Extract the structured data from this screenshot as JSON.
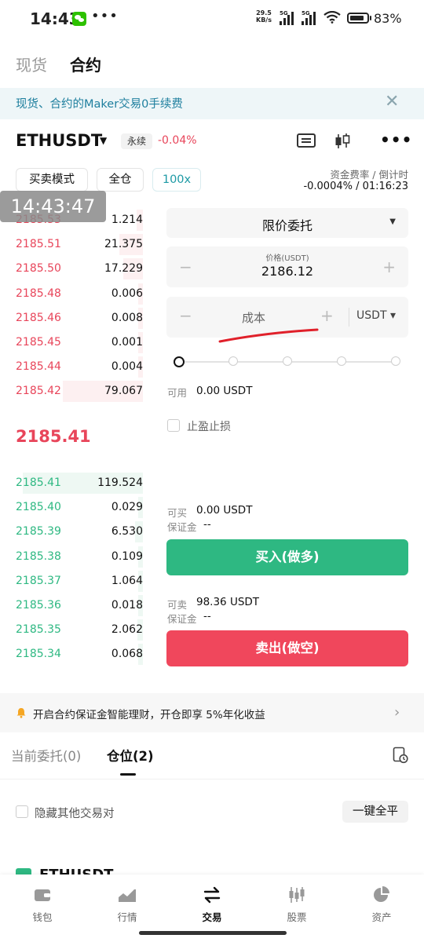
{
  "status_bar": {
    "time": "14:43",
    "dots": "•••",
    "net_speed_value": "29.5",
    "net_speed_unit": "KB/s",
    "signal_label": "5G",
    "battery_pct": "83%"
  },
  "top_tabs": {
    "spot": "现货",
    "futures": "合约"
  },
  "banner": {
    "text": "现货、合约的Maker交易0手续费",
    "close": "✕"
  },
  "header": {
    "symbol": "ETHUSDT",
    "caret": "▼",
    "tag": "永续",
    "change": "-0.04%"
  },
  "modes": {
    "trade_mode": "买卖模式",
    "margin_mode": "全仓",
    "leverage": "100x"
  },
  "funding": {
    "label": "资金费率 / 倒计时",
    "value": "-0.0004% / 01:16:23"
  },
  "overlay_time": "14:43:47",
  "orderbook": {
    "asks": [
      {
        "price": "2185.53",
        "qty": "1.214",
        "depth": 0.05
      },
      {
        "price": "2185.51",
        "qty": "21.375",
        "depth": 0.18
      },
      {
        "price": "2185.50",
        "qty": "17.229",
        "depth": 0.15
      },
      {
        "price": "2185.48",
        "qty": "0.006",
        "depth": 0.02
      },
      {
        "price": "2185.46",
        "qty": "0.008",
        "depth": 0.02
      },
      {
        "price": "2185.45",
        "qty": "0.001",
        "depth": 0.02
      },
      {
        "price": "2185.44",
        "qty": "0.004",
        "depth": 0.02
      },
      {
        "price": "2185.42",
        "qty": "79.067",
        "depth": 0.62
      }
    ],
    "mid_price": "2185.41",
    "bids": [
      {
        "price": "2185.41",
        "qty": "119.524",
        "depth": 0.93
      },
      {
        "price": "2185.40",
        "qty": "0.029",
        "depth": 0.02
      },
      {
        "price": "2185.39",
        "qty": "6.530",
        "depth": 0.06
      },
      {
        "price": "2185.38",
        "qty": "0.109",
        "depth": 0.02
      },
      {
        "price": "2185.37",
        "qty": "1.064",
        "depth": 0.03
      },
      {
        "price": "2185.36",
        "qty": "0.018",
        "depth": 0.02
      },
      {
        "price": "2185.35",
        "qty": "2.062",
        "depth": 0.04
      },
      {
        "price": "2185.34",
        "qty": "0.068",
        "depth": 0.02
      }
    ]
  },
  "order_form": {
    "order_type": "限价委托",
    "price_label": "价格(USDT)",
    "price_value": "2186.12",
    "minus": "−",
    "plus": "+",
    "cost_placeholder": "成本",
    "unit": "USDT",
    "slider_percent": 0,
    "available_label": "可用",
    "available_value": "0.00 USDT",
    "tpsl_label": "止盈止损",
    "buy_can_label": "可买",
    "buy_can_value": "0.00 USDT",
    "buy_margin_label": "保证金",
    "buy_margin_value": "--",
    "buy_button": "买入(做多)",
    "sell_can_label": "可卖",
    "sell_can_value": "98.36 USDT",
    "sell_margin_label": "保证金",
    "sell_margin_value": "--",
    "sell_button": "卖出(做空)"
  },
  "promo": {
    "text": "开启合约保证金智能理财，开仓即享 5%年化收益",
    "chevron": "›"
  },
  "position_tabs": {
    "open_orders": "当前委托(0)",
    "positions": "仓位(2)"
  },
  "positions_panel": {
    "hide_others": "隐藏其他交易对",
    "close_all": "一键全平",
    "peek_symbol": "ETHUSDT"
  },
  "bottom_nav": [
    {
      "label": "钱包",
      "icon": "wallet-icon"
    },
    {
      "label": "行情",
      "icon": "market-chart-icon"
    },
    {
      "label": "交易",
      "icon": "trade-arrows-icon",
      "active": true
    },
    {
      "label": "股票",
      "icon": "stock-candles-icon"
    },
    {
      "label": "资产",
      "icon": "assets-pie-icon"
    }
  ],
  "colors": {
    "bid_green": "#2eb882",
    "ask_red": "#e8455a",
    "sell_button": "#f0475c",
    "banner_text": "#1e7f9e",
    "leverage_teal": "#1e9aa5"
  }
}
